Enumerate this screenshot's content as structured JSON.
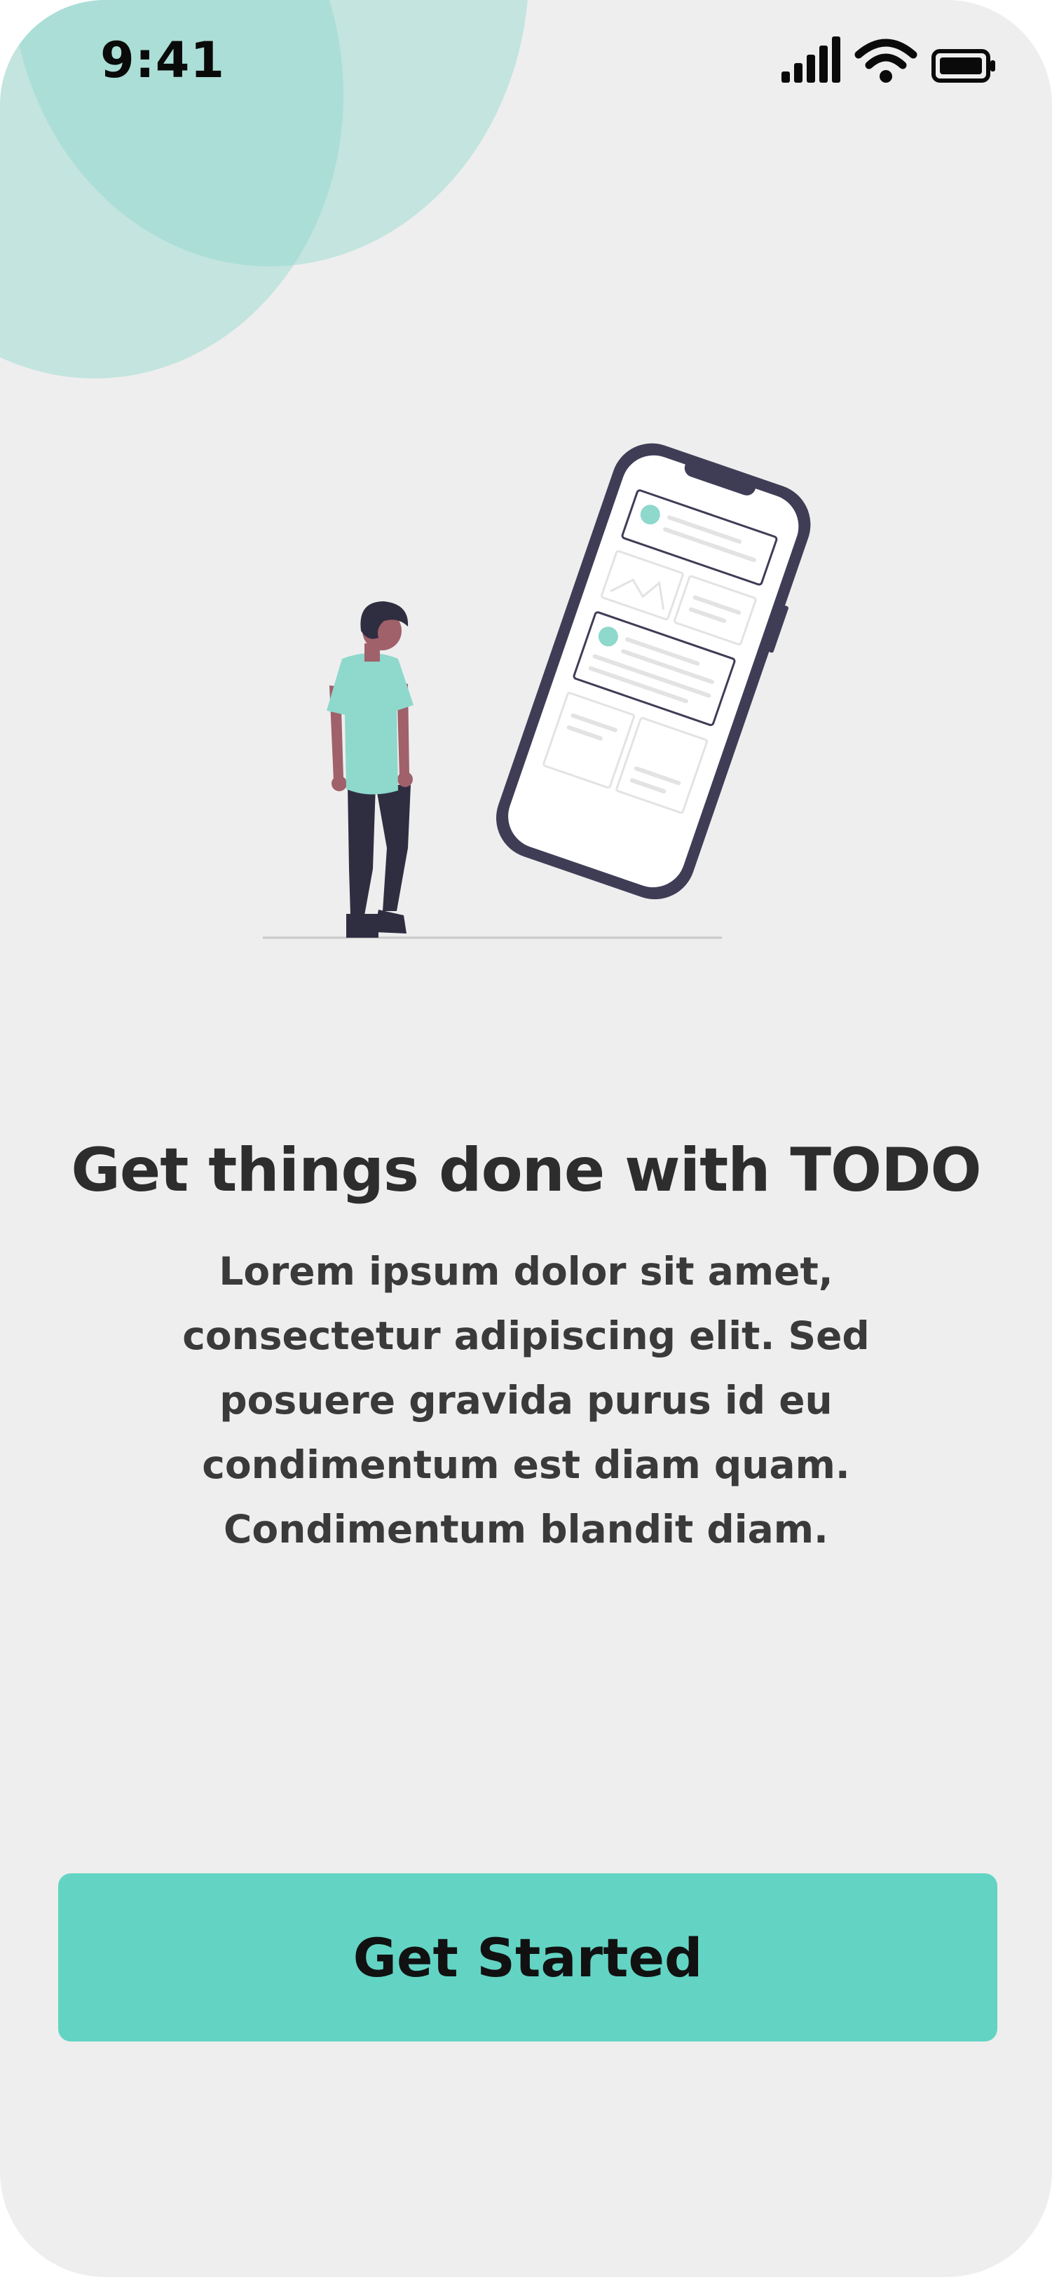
{
  "status_bar": {
    "time": "9:41",
    "icons": [
      "cellular-signal-icon",
      "wifi-icon",
      "battery-icon"
    ]
  },
  "illustration": {
    "icon": "person-with-phone-illustration"
  },
  "onboarding": {
    "title": "Get things done with TODO",
    "description": "Lorem ipsum dolor sit amet, consectetur adipiscing elit. Sed posuere gravida purus id eu condimentum est diam quam. Condimentum blandit diam.",
    "cta_label": "Get Started"
  },
  "colors": {
    "accent": "#63D4C4",
    "blob": "#8ED8CC",
    "background": "#EEEEEE",
    "text": "#2D2D2D",
    "phone_frame": "#3F3D56",
    "skin": "#A0616A"
  }
}
